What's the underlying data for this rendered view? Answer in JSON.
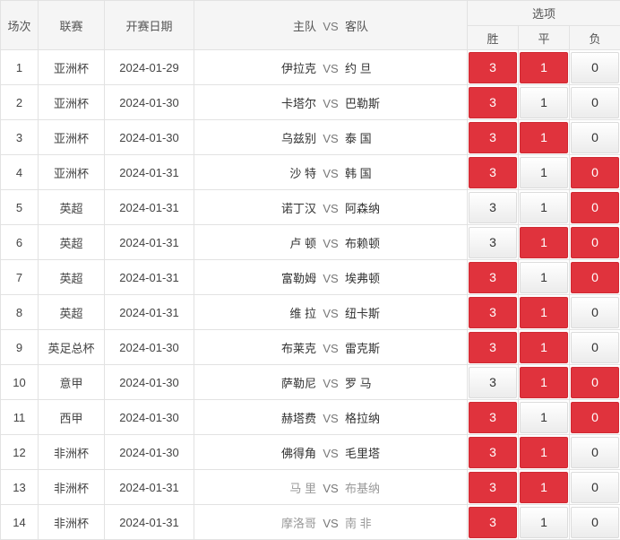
{
  "headers": {
    "round": "场次",
    "league": "联赛",
    "date": "开赛日期",
    "home": "主队",
    "vs": "VS",
    "away": "客队",
    "options": "选项",
    "win": "胜",
    "draw": "平",
    "lose": "负"
  },
  "colors": {
    "selected": "#e0333d",
    "unselected": "#f2f2f2"
  },
  "rows": [
    {
      "no": "1",
      "league": "亚洲杯",
      "date": "2024-01-29",
      "home": "伊拉克",
      "away": "约 旦",
      "win": "3",
      "draw": "1",
      "lose": "0",
      "sel": [
        true,
        true,
        false
      ],
      "dim": false
    },
    {
      "no": "2",
      "league": "亚洲杯",
      "date": "2024-01-30",
      "home": "卡塔尔",
      "away": "巴勒斯",
      "win": "3",
      "draw": "1",
      "lose": "0",
      "sel": [
        true,
        false,
        false
      ],
      "dim": false
    },
    {
      "no": "3",
      "league": "亚洲杯",
      "date": "2024-01-30",
      "home": "乌兹别",
      "away": "泰 国",
      "win": "3",
      "draw": "1",
      "lose": "0",
      "sel": [
        true,
        true,
        false
      ],
      "dim": false
    },
    {
      "no": "4",
      "league": "亚洲杯",
      "date": "2024-01-31",
      "home": "沙 特",
      "away": "韩 国",
      "win": "3",
      "draw": "1",
      "lose": "0",
      "sel": [
        true,
        false,
        true
      ],
      "dim": false
    },
    {
      "no": "5",
      "league": "英超",
      "date": "2024-01-31",
      "home": "诺丁汉",
      "away": "阿森纳",
      "win": "3",
      "draw": "1",
      "lose": "0",
      "sel": [
        false,
        false,
        true
      ],
      "dim": false
    },
    {
      "no": "6",
      "league": "英超",
      "date": "2024-01-31",
      "home": "卢 顿",
      "away": "布赖顿",
      "win": "3",
      "draw": "1",
      "lose": "0",
      "sel": [
        false,
        true,
        true
      ],
      "dim": false
    },
    {
      "no": "7",
      "league": "英超",
      "date": "2024-01-31",
      "home": "富勒姆",
      "away": "埃弗顿",
      "win": "3",
      "draw": "1",
      "lose": "0",
      "sel": [
        true,
        false,
        true
      ],
      "dim": false
    },
    {
      "no": "8",
      "league": "英超",
      "date": "2024-01-31",
      "home": "维 拉",
      "away": "纽卡斯",
      "win": "3",
      "draw": "1",
      "lose": "0",
      "sel": [
        true,
        true,
        false
      ],
      "dim": false
    },
    {
      "no": "9",
      "league": "英足总杯",
      "date": "2024-01-30",
      "home": "布莱克",
      "away": "雷克斯",
      "win": "3",
      "draw": "1",
      "lose": "0",
      "sel": [
        true,
        true,
        false
      ],
      "dim": false
    },
    {
      "no": "10",
      "league": "意甲",
      "date": "2024-01-30",
      "home": "萨勒尼",
      "away": "罗 马",
      "win": "3",
      "draw": "1",
      "lose": "0",
      "sel": [
        false,
        true,
        true
      ],
      "dim": false
    },
    {
      "no": "11",
      "league": "西甲",
      "date": "2024-01-30",
      "home": "赫塔费",
      "away": "格拉纳",
      "win": "3",
      "draw": "1",
      "lose": "0",
      "sel": [
        true,
        false,
        true
      ],
      "dim": false
    },
    {
      "no": "12",
      "league": "非洲杯",
      "date": "2024-01-30",
      "home": "佛得角",
      "away": "毛里塔",
      "win": "3",
      "draw": "1",
      "lose": "0",
      "sel": [
        true,
        true,
        false
      ],
      "dim": false
    },
    {
      "no": "13",
      "league": "非洲杯",
      "date": "2024-01-31",
      "home": "马 里",
      "away": "布基纳",
      "win": "3",
      "draw": "1",
      "lose": "0",
      "sel": [
        true,
        true,
        false
      ],
      "dim": true
    },
    {
      "no": "14",
      "league": "非洲杯",
      "date": "2024-01-31",
      "home": "摩洛哥",
      "away": "南 非",
      "win": "3",
      "draw": "1",
      "lose": "0",
      "sel": [
        true,
        false,
        false
      ],
      "dim": true
    }
  ]
}
